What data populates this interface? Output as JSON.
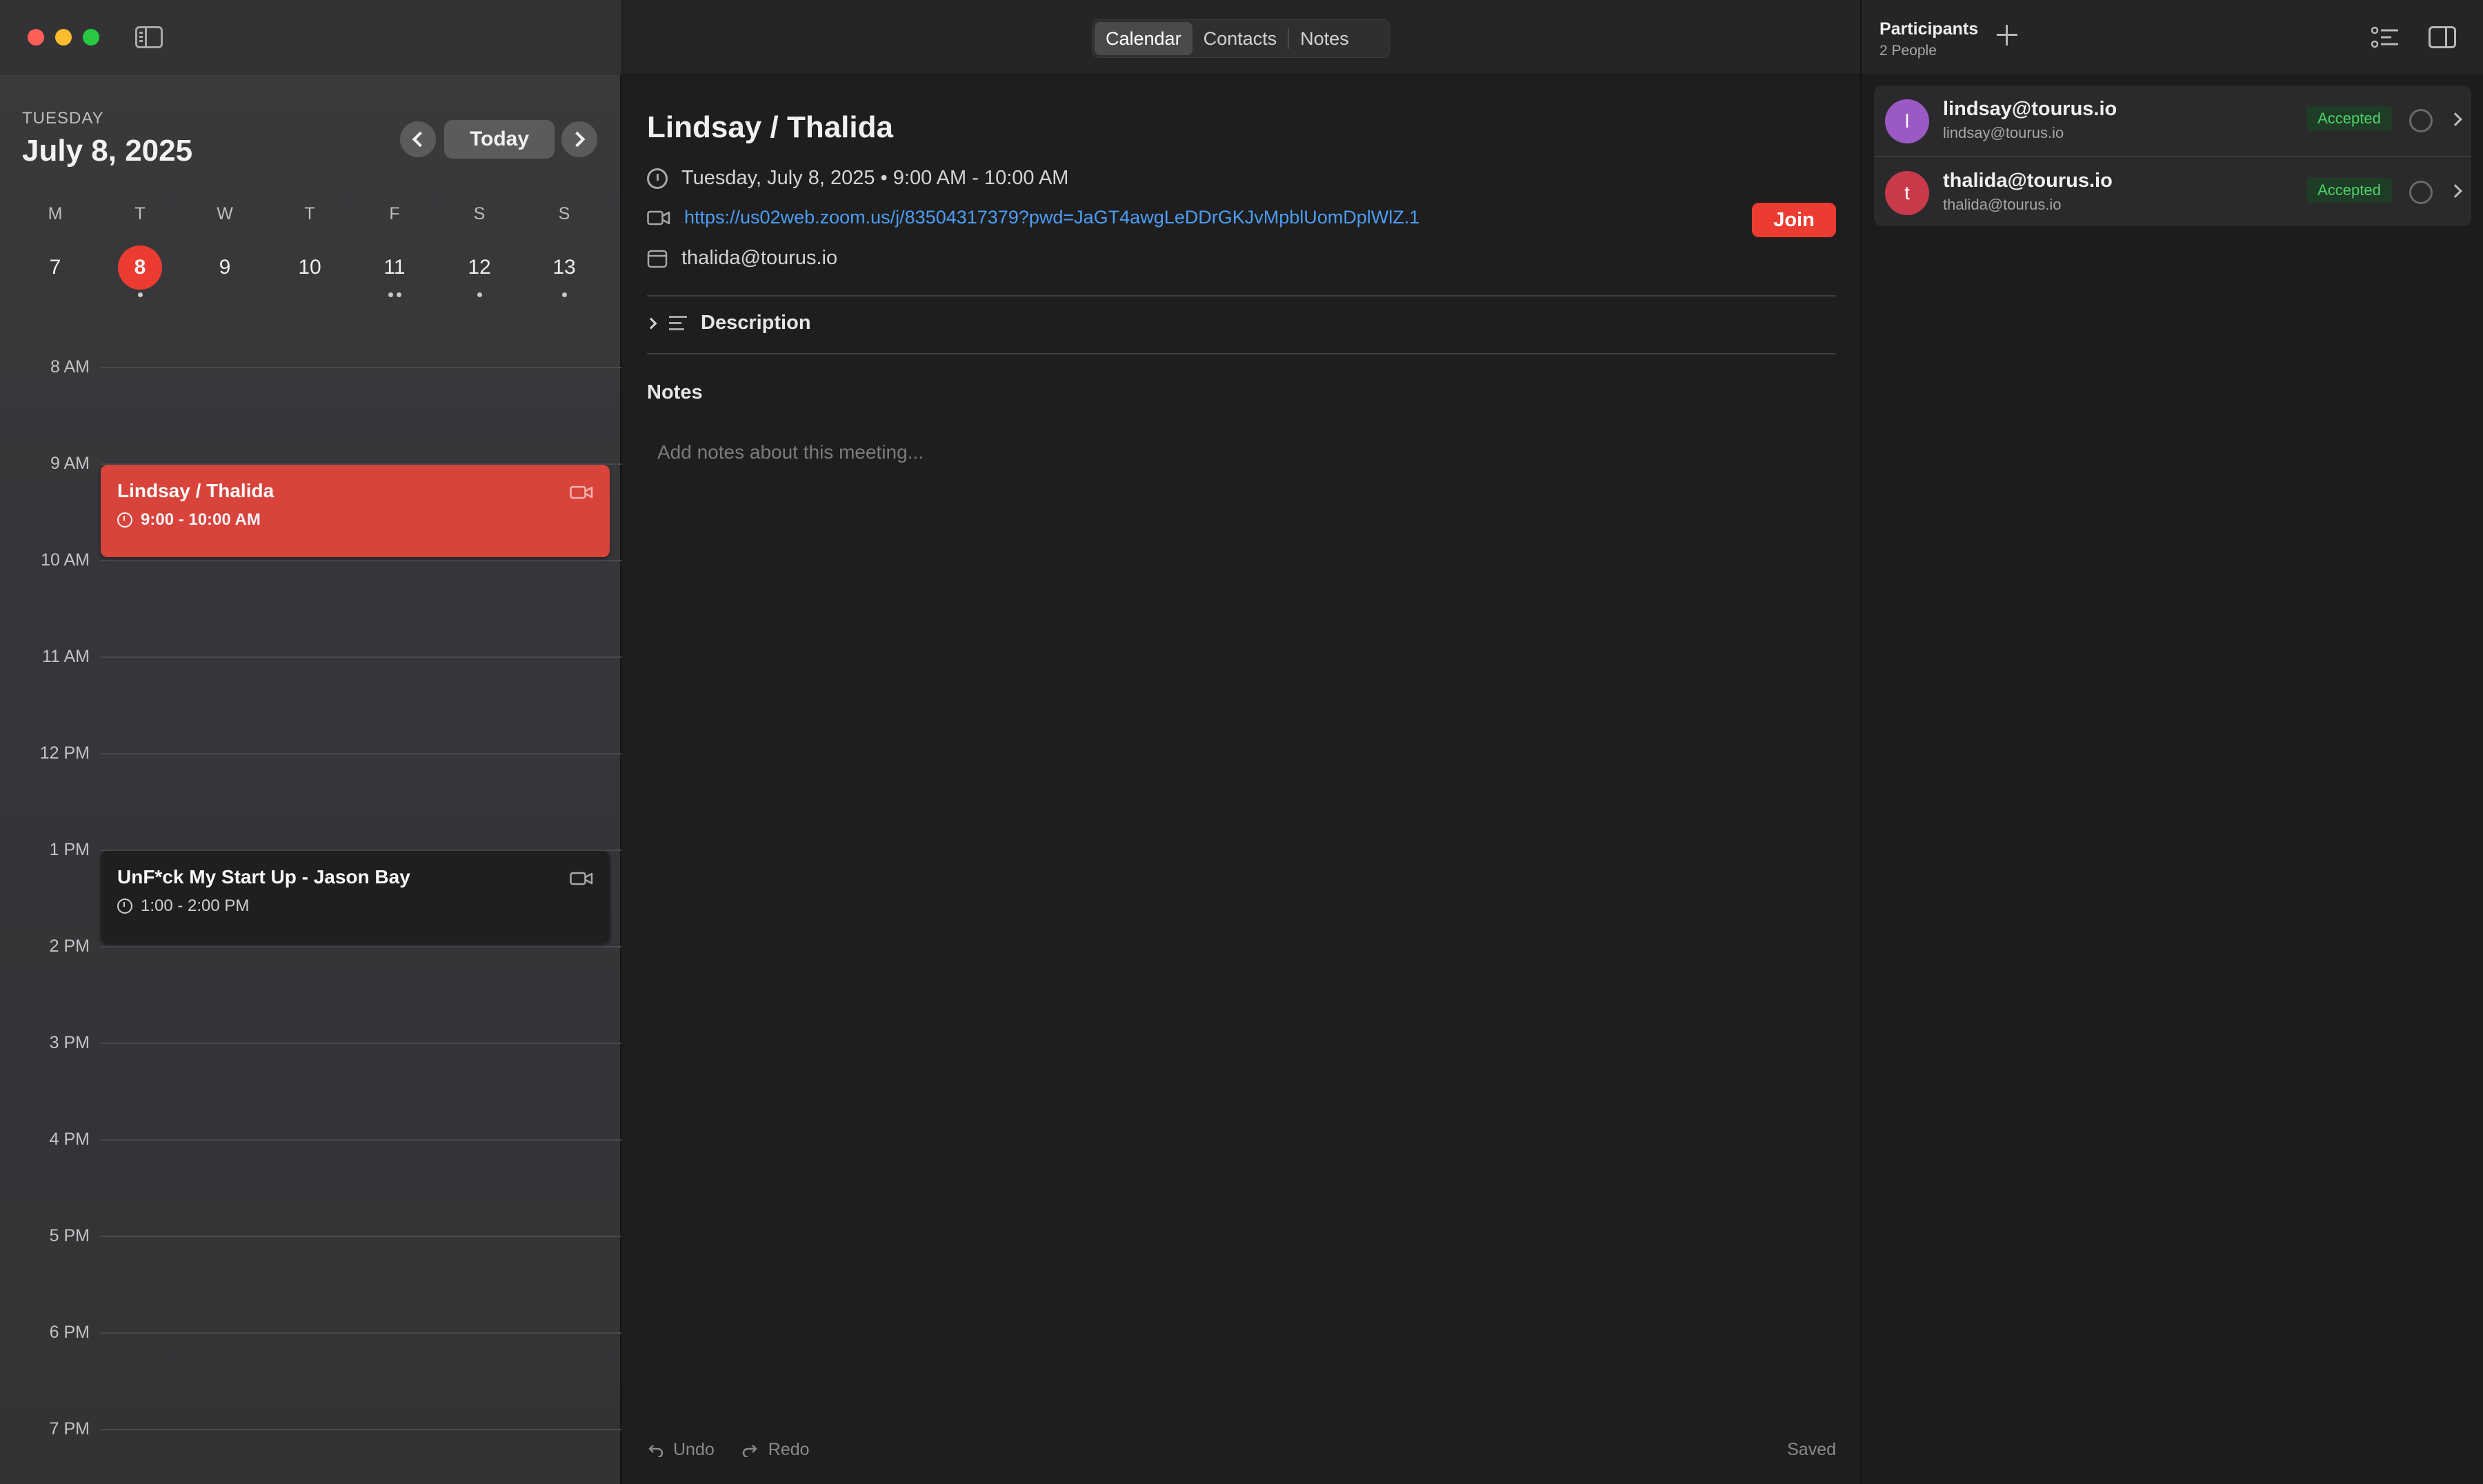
{
  "sidebar": {
    "weekday": "TUESDAY",
    "date": "July 8, 2025",
    "today_label": "Today",
    "week": [
      {
        "letter": "M",
        "num": "7",
        "dots": 0,
        "selected": false
      },
      {
        "letter": "T",
        "num": "8",
        "dots": 1,
        "selected": true
      },
      {
        "letter": "W",
        "num": "9",
        "dots": 0,
        "selected": false
      },
      {
        "letter": "T",
        "num": "10",
        "dots": 0,
        "selected": false
      },
      {
        "letter": "F",
        "num": "11",
        "dots": 2,
        "selected": false
      },
      {
        "letter": "S",
        "num": "12",
        "dots": 1,
        "selected": false
      },
      {
        "letter": "S",
        "num": "13",
        "dots": 1,
        "selected": false
      }
    ],
    "hours": [
      "8 AM",
      "9 AM",
      "10 AM",
      "11 AM",
      "12 PM",
      "1 PM",
      "2 PM",
      "3 PM",
      "4 PM",
      "5 PM",
      "6 PM",
      "7 PM"
    ],
    "events": [
      {
        "title": "Lindsay / Thalida",
        "time": "9:00 - 10:00 AM"
      },
      {
        "title": "UnF*ck My Start Up - Jason Bay",
        "time": "1:00 - 2:00 PM"
      }
    ]
  },
  "tabs": {
    "calendar": "Calendar",
    "contacts": "Contacts",
    "notes": "Notes"
  },
  "detail": {
    "title": "Lindsay / Thalida",
    "datetime": "Tuesday, July 8, 2025 • 9:00 AM - 10:00 AM",
    "link": "https://us02web.zoom.us/j/83504317379?pwd=JaGT4awgLeDDrGKJvMpblUomDplWlZ.1",
    "join_label": "Join",
    "calendar_account": "thalida@tourus.io",
    "description_label": "Description",
    "notes_heading": "Notes",
    "notes_placeholder": "Add notes about this meeting...",
    "undo_label": "Undo",
    "redo_label": "Redo",
    "status": "Saved"
  },
  "participants": {
    "title": "Participants",
    "count": "2 People",
    "list": [
      {
        "initial": "l",
        "name": "lindsay@tourus.io",
        "email": "lindsay@tourus.io",
        "status": "Accepted",
        "color": "#9b59c4"
      },
      {
        "initial": "t",
        "name": "thalida@tourus.io",
        "email": "thalida@tourus.io",
        "status": "Accepted",
        "color": "#c83a4a"
      }
    ]
  },
  "colors": {
    "accent": "#ec3c32",
    "link": "#4b9df5",
    "accepted": "#4fd26c"
  }
}
